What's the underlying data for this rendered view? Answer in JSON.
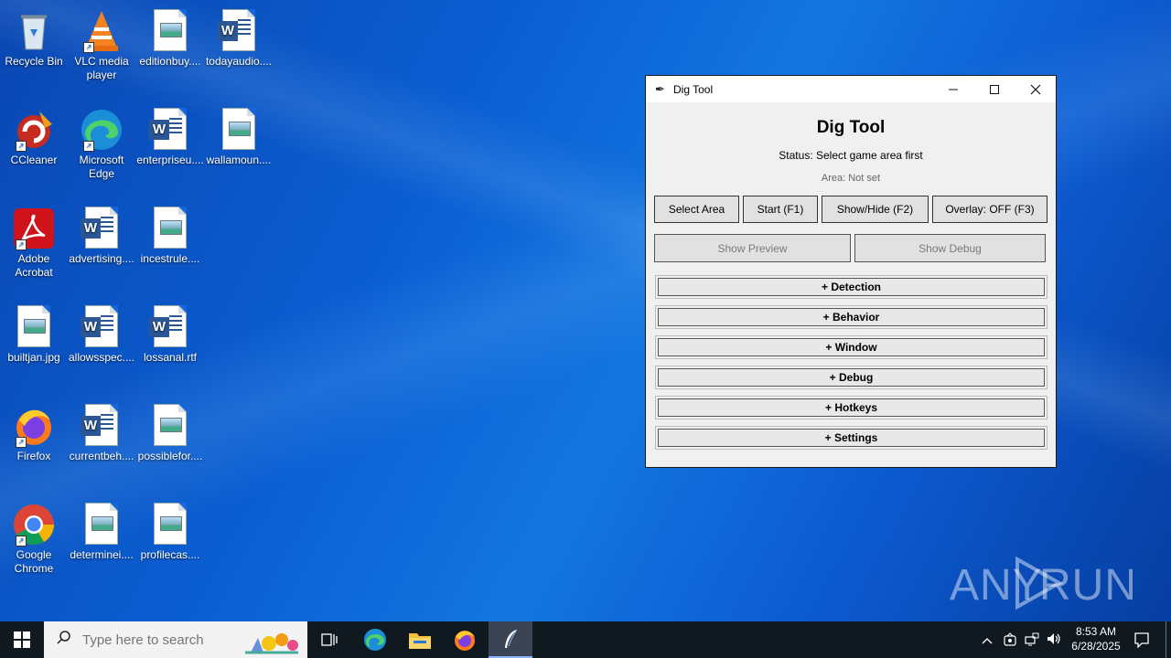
{
  "desktop": {
    "icons": [
      {
        "label": "Recycle Bin",
        "icon": "recycle-bin-icon"
      },
      {
        "label": "VLC media player",
        "icon": "vlc-icon"
      },
      {
        "label": "editionbuy....",
        "icon": "image-file-icon"
      },
      {
        "label": "todayaudio....",
        "icon": "word-doc-icon"
      },
      {
        "label": "CCleaner",
        "icon": "ccleaner-icon"
      },
      {
        "label": "Microsoft Edge",
        "icon": "edge-icon"
      },
      {
        "label": "enterpriseu....",
        "icon": "word-doc-icon"
      },
      {
        "label": "wallamoun....",
        "icon": "image-file-icon"
      },
      {
        "label": "Adobe Acrobat",
        "icon": "acrobat-icon"
      },
      {
        "label": "advertising....",
        "icon": "word-doc-icon"
      },
      {
        "label": "incestrule....",
        "icon": "image-file-icon"
      },
      {
        "label": "builtjan.jpg",
        "icon": "image-file-icon"
      },
      {
        "label": "allowsspec....",
        "icon": "word-doc-icon"
      },
      {
        "label": "lossanal.rtf",
        "icon": "word-doc-icon"
      },
      {
        "label": "Firefox",
        "icon": "firefox-icon"
      },
      {
        "label": "currentbeh....",
        "icon": "word-doc-icon"
      },
      {
        "label": "possiblefor....",
        "icon": "image-file-icon"
      },
      {
        "label": "Google Chrome",
        "icon": "chrome-icon"
      },
      {
        "label": "determinei....",
        "icon": "image-file-icon"
      },
      {
        "label": "profilecas....",
        "icon": "image-file-icon"
      }
    ]
  },
  "window": {
    "title": "Dig Tool",
    "heading": "Dig Tool",
    "status": "Status: Select game area first",
    "area": "Area: Not set",
    "buttons": {
      "select_area": "Select Area",
      "start": "Start (F1)",
      "show_hide": "Show/Hide (F2)",
      "overlay": "Overlay: OFF (F3)",
      "show_preview": "Show Preview",
      "show_debug": "Show Debug"
    },
    "sections": [
      "+ Detection",
      "+ Behavior",
      "+ Window",
      "+ Debug",
      "+ Hotkeys",
      "+ Settings"
    ]
  },
  "watermark": "ANY RUN",
  "taskbar": {
    "search_placeholder": "Type here to search",
    "time": "8:53 AM",
    "date": "6/28/2025"
  }
}
